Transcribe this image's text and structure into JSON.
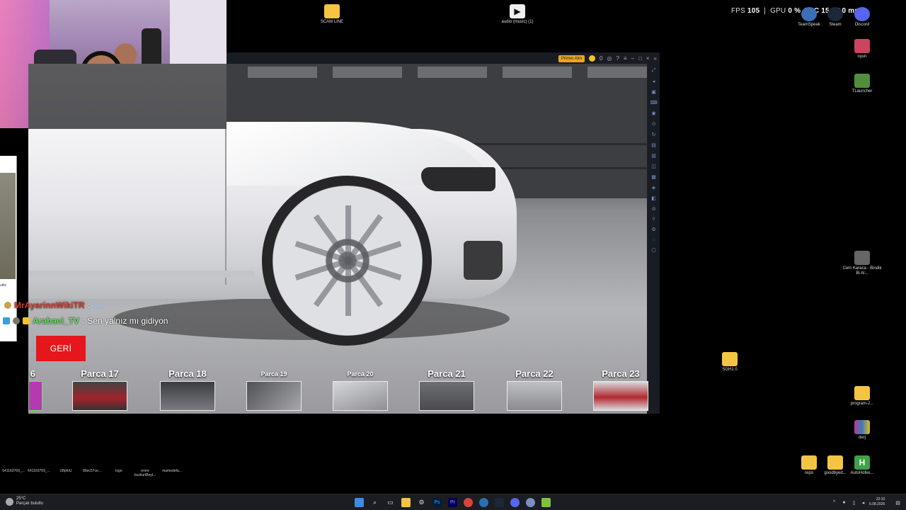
{
  "hud": {
    "fps_label": "FPS",
    "fps_value": "105",
    "gpu_label": "GPU",
    "gpu_value": "0 %",
    "gpu_temp": "42°C",
    "extra": "15",
    "lat_label": "AT",
    "lat_value": "0 ms"
  },
  "desktop_icons_top": [
    {
      "label": "SCAM LINE",
      "icon": "folder-icon"
    },
    {
      "label": "audio (music) (1)",
      "icon": "audio-file-icon"
    },
    {
      "label": "TeamSpeak",
      "icon": "teamspeak-icon"
    },
    {
      "label": "Steam",
      "icon": "steam-icon"
    },
    {
      "label": "Discord",
      "icon": "discord-icon"
    }
  ],
  "desktop_icons_right": [
    {
      "label": "oyun",
      "icon": "app-icon"
    },
    {
      "label": "TLauncher",
      "icon": "minecraft-icon"
    },
    {
      "label": "Cem Karaca - Bindik Bi Al...",
      "icon": "video-icon"
    },
    {
      "label": "SGH1.0",
      "icon": "folder-icon"
    },
    {
      "label": "program-2...",
      "icon": "folder-icon"
    },
    {
      "label": "derj",
      "icon": "winrar-icon"
    },
    {
      "label": "repo",
      "icon": "folder-icon"
    },
    {
      "label": "goodbyed...",
      "icon": "folder-icon"
    },
    {
      "label": "AutoHotke...",
      "icon": "autohotkey-icon"
    }
  ],
  "desktop_icons_bottom": [
    {
      "label": "641163769_...",
      "icon": "image-icon"
    },
    {
      "label": "641163769_...",
      "icon": "image-icon"
    },
    {
      "label": "U8pfoU",
      "icon": "image-icon"
    },
    {
      "label": "86ec57ce...",
      "icon": "image-icon"
    },
    {
      "label": "logo",
      "icon": "image-icon"
    },
    {
      "label": "emre bozkurtBeyl...",
      "icon": "image-icon"
    },
    {
      "label": "mamedefa...",
      "icon": "image-icon"
    }
  ],
  "emulator": {
    "promo_label": "Primeı Alın",
    "coin_count": "0"
  },
  "chat": [
    {
      "user": "MrAyarinnWikiTR",
      "sep": ":",
      "message": ""
    },
    {
      "user": "Arabaci_TV",
      "sep": ":",
      "message": "Sen yalnız mı gidiyon"
    }
  ],
  "game": {
    "back_button": "GERİ",
    "parts": [
      {
        "label": "6"
      },
      {
        "label": "Parca 17"
      },
      {
        "label": "Parca 18"
      },
      {
        "label": "Parca 19"
      },
      {
        "label": "Parca 20"
      },
      {
        "label": "Parca 21"
      },
      {
        "label": "Parca 22"
      },
      {
        "label": "Parca 23"
      }
    ]
  },
  "left_panel": {
    "text": "ukle"
  },
  "taskbar": {
    "weather_temp": "25°C",
    "weather_desc": "Parçalı bulutlu",
    "time": "22:10",
    "date": "6.08.2026"
  },
  "colors": {
    "accent_red": "#e5171c",
    "chat_user_a": "#d93a2b",
    "chat_user_b": "#65e05a",
    "promo": "#e8a623"
  }
}
